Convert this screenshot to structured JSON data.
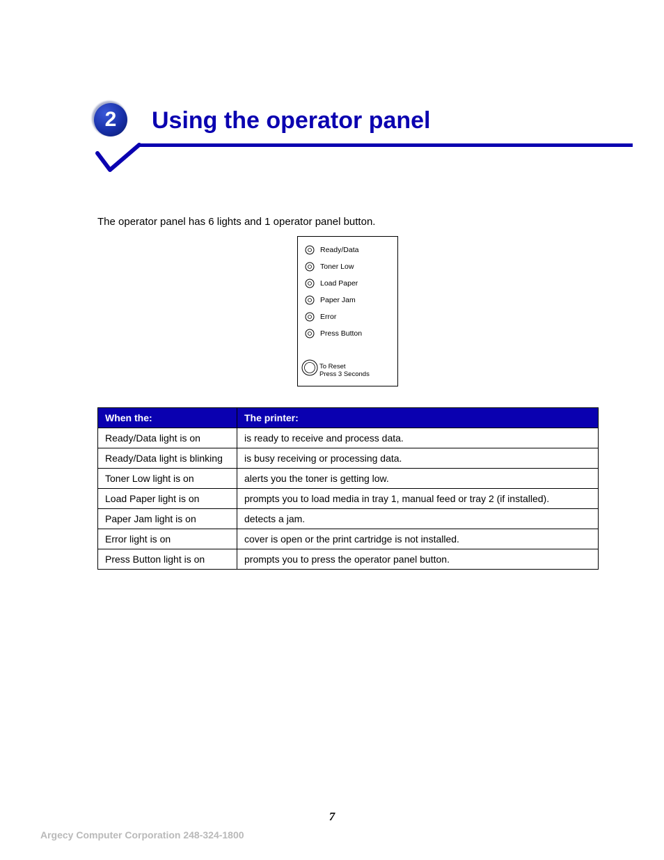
{
  "chapter": {
    "number": "2",
    "title": "Using the operator panel"
  },
  "intro": "The operator panel has 6 lights and 1 operator panel button.",
  "panel": {
    "lights": [
      "Ready/Data",
      "Toner Low",
      "Load Paper",
      "Paper Jam",
      "Error",
      "Press Button"
    ],
    "reset_line1": "To Reset",
    "reset_line2": "Press 3 Seconds"
  },
  "table": {
    "headers": {
      "col1": "When the:",
      "col2": "The printer:"
    },
    "rows": [
      {
        "when": "Ready/Data light is on",
        "printer": "is ready to receive and process data."
      },
      {
        "when": "Ready/Data light is blinking",
        "printer": "is busy receiving or processing data."
      },
      {
        "when": "Toner Low light is on",
        "printer": "alerts you the toner is getting low."
      },
      {
        "when": "Load Paper light is on",
        "printer": "prompts you to load media in tray 1, manual feed or tray 2 (if installed)."
      },
      {
        "when": "Paper Jam light is on",
        "printer": "detects a jam."
      },
      {
        "when": "Error light is on",
        "printer": "cover is open or the print cartridge is not installed."
      },
      {
        "when": "Press Button light is on",
        "printer": "prompts you to press the operator panel button."
      }
    ]
  },
  "page_number": "7",
  "footer": "Argecy Computer Corporation 248-324-1800"
}
